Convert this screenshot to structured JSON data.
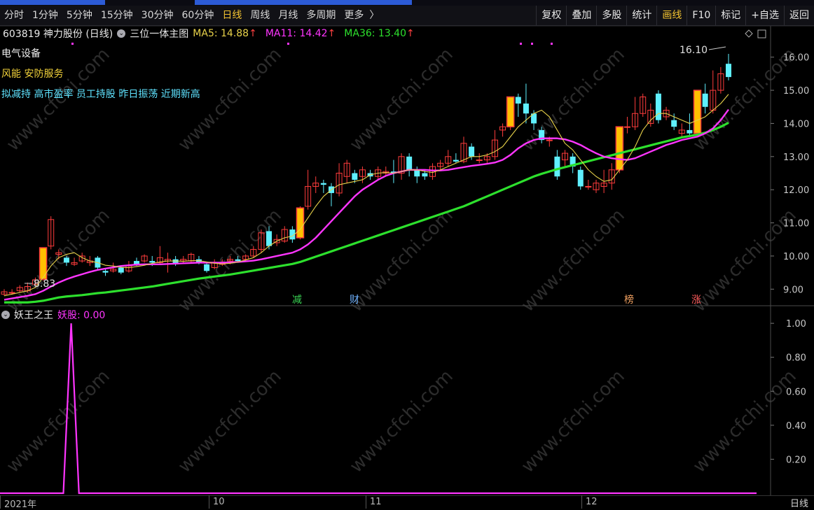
{
  "tabs": [
    "分时",
    "1分钟",
    "5分钟",
    "15分钟",
    "30分钟",
    "60分钟",
    "日线",
    "周线",
    "月线",
    "多周期",
    "更多"
  ],
  "active_tab": "日线",
  "right_buttons": [
    "复权",
    "叠加",
    "多股",
    "统计",
    "画线",
    "F10",
    "标记",
    "+自选",
    "返回"
  ],
  "highlight_button": "画线",
  "title": {
    "code_name": "603819 神力股份 (日线)",
    "indicator": "三位一体主图",
    "ma5": "MA5: 14.88",
    "ma11": "MA11: 14.42",
    "ma36": "MA36: 13.40",
    "arrow": "↑"
  },
  "annotations": {
    "industry": "电气设备",
    "concepts": "风能 安防服务",
    "tags": "拟减持 高市盈率 员工持股 昨日振荡 近期新高"
  },
  "sub": {
    "name": "妖王之王",
    "value": "妖股: 0.00"
  },
  "markers": [
    {
      "label": "减",
      "color": "#39d353"
    },
    {
      "label": "财",
      "color": "#6fb2ff"
    },
    {
      "label": "榜",
      "color": "#f0a060"
    },
    {
      "label": "涨",
      "color": "#ff5b5b"
    }
  ],
  "price_axis": [
    "16.00",
    "15.00",
    "14.00",
    "13.00",
    "12.00",
    "11.00",
    "10.00",
    "9.00"
  ],
  "sub_axis": [
    "1.00",
    "0.80",
    "0.60",
    "0.40",
    "0.20"
  ],
  "high_label": "16.10",
  "low_label": "8.83",
  "date_labels": [
    "2021年",
    "10",
    "11",
    "12"
  ],
  "period_label": "日线",
  "watermark": "www.cfchi.com",
  "colors": {
    "up": "#ff3c3c",
    "down": "#5ff0ff",
    "ma5": "#e8d24a",
    "ma11": "#ff35ff",
    "ma36": "#2de02d",
    "special": "#ffc000",
    "sub_line": "#ff35ff"
  },
  "chart_data": {
    "type": "candlestick",
    "ylim": [
      8.5,
      16.5
    ],
    "candles": [
      [
        8.85,
        8.92,
        8.8,
        9.0
      ],
      [
        8.9,
        8.9,
        8.83,
        9.0
      ],
      [
        8.95,
        9.05,
        8.9,
        9.12
      ],
      [
        8.95,
        9.08,
        8.9,
        9.2
      ],
      [
        9.15,
        9.28,
        9.1,
        9.35
      ],
      [
        9.3,
        10.25,
        9.25,
        10.25
      ],
      [
        10.3,
        11.1,
        10.2,
        11.2
      ],
      [
        10.05,
        10.1,
        9.9,
        10.2
      ],
      [
        9.95,
        9.8,
        9.7,
        10.0
      ],
      [
        9.75,
        9.8,
        9.7,
        9.95
      ],
      [
        9.85,
        10.0,
        9.8,
        10.1
      ],
      [
        9.8,
        9.85,
        9.7,
        10.0
      ],
      [
        9.95,
        9.65,
        9.6,
        10.0
      ],
      [
        9.55,
        9.5,
        9.4,
        9.6
      ],
      [
        9.55,
        9.6,
        9.5,
        9.8
      ],
      [
        9.65,
        9.5,
        9.45,
        9.7
      ],
      [
        9.55,
        9.7,
        9.5,
        9.85
      ],
      [
        9.85,
        9.75,
        9.7,
        9.95
      ],
      [
        9.85,
        10.0,
        9.8,
        10.05
      ],
      [
        9.85,
        9.8,
        9.7,
        10.0
      ],
      [
        9.8,
        9.95,
        9.75,
        10.3
      ],
      [
        9.85,
        9.9,
        9.5,
        10.1
      ],
      [
        9.9,
        9.75,
        9.7,
        10.0
      ],
      [
        9.85,
        9.9,
        9.8,
        10.0
      ],
      [
        9.85,
        10.05,
        9.8,
        10.1
      ],
      [
        9.9,
        9.8,
        9.75,
        10.0
      ],
      [
        9.75,
        9.55,
        9.5,
        9.8
      ],
      [
        9.65,
        9.8,
        9.6,
        9.9
      ],
      [
        9.75,
        9.8,
        9.7,
        9.9
      ],
      [
        9.85,
        9.9,
        9.75,
        10.0
      ],
      [
        9.9,
        9.85,
        9.8,
        10.0
      ],
      [
        9.9,
        10.0,
        9.85,
        10.05
      ],
      [
        10.0,
        10.2,
        9.95,
        10.3
      ],
      [
        10.2,
        10.7,
        10.1,
        10.8
      ],
      [
        10.75,
        10.3,
        10.2,
        10.9
      ],
      [
        10.4,
        10.5,
        10.3,
        10.65
      ],
      [
        10.45,
        10.8,
        10.4,
        10.9
      ],
      [
        10.8,
        10.5,
        10.4,
        10.9
      ],
      [
        10.55,
        11.45,
        10.5,
        11.5
      ],
      [
        11.5,
        12.1,
        11.4,
        12.6
      ],
      [
        12.1,
        12.2,
        11.9,
        12.4
      ],
      [
        12.2,
        12.15,
        11.9,
        12.3
      ],
      [
        12.1,
        11.9,
        11.5,
        12.2
      ],
      [
        11.9,
        12.5,
        11.8,
        12.8
      ],
      [
        12.4,
        12.8,
        12.2,
        12.9
      ],
      [
        12.5,
        12.3,
        12.2,
        12.6
      ],
      [
        12.4,
        12.6,
        12.2,
        12.7
      ],
      [
        12.5,
        12.4,
        12.3,
        12.6
      ],
      [
        12.4,
        12.6,
        12.3,
        12.7
      ],
      [
        12.5,
        12.55,
        12.4,
        12.7
      ],
      [
        12.55,
        12.5,
        12.2,
        12.9
      ],
      [
        12.5,
        13.0,
        12.3,
        13.1
      ],
      [
        13.0,
        12.6,
        12.4,
        13.1
      ],
      [
        12.6,
        12.4,
        12.2,
        12.7
      ],
      [
        12.5,
        12.4,
        12.3,
        12.6
      ],
      [
        12.4,
        12.7,
        12.3,
        12.8
      ],
      [
        12.7,
        12.8,
        12.6,
        12.9
      ],
      [
        12.8,
        13.0,
        12.7,
        13.2
      ],
      [
        12.9,
        12.85,
        12.8,
        13.1
      ],
      [
        12.85,
        13.4,
        12.8,
        13.6
      ],
      [
        13.3,
        13.0,
        12.9,
        13.4
      ],
      [
        12.9,
        12.9,
        12.8,
        13.1
      ],
      [
        12.9,
        13.0,
        12.8,
        13.1
      ],
      [
        13.0,
        13.5,
        12.9,
        13.8
      ],
      [
        13.8,
        13.9,
        13.6,
        14.0
      ],
      [
        13.9,
        14.8,
        13.8,
        14.8
      ],
      [
        14.8,
        14.6,
        14.2,
        14.9
      ],
      [
        14.6,
        14.3,
        14.0,
        15.2
      ],
      [
        14.3,
        14.0,
        13.8,
        14.4
      ],
      [
        13.8,
        13.5,
        13.4,
        13.9
      ],
      [
        13.5,
        13.5,
        13.3,
        13.6
      ],
      [
        13.0,
        12.4,
        12.3,
        13.2
      ],
      [
        12.9,
        13.1,
        12.7,
        13.2
      ],
      [
        13.0,
        12.7,
        12.5,
        13.1
      ],
      [
        12.6,
        12.1,
        12.0,
        12.7
      ],
      [
        12.1,
        12.1,
        12.0,
        12.3
      ],
      [
        12.0,
        12.2,
        11.9,
        12.3
      ],
      [
        12.1,
        12.2,
        11.9,
        12.6
      ],
      [
        12.2,
        12.6,
        12.0,
        12.8
      ],
      [
        12.6,
        13.9,
        12.5,
        13.9
      ],
      [
        13.9,
        13.9,
        13.7,
        14.2
      ],
      [
        13.9,
        14.3,
        13.8,
        14.8
      ],
      [
        14.3,
        14.8,
        14.2,
        14.9
      ],
      [
        14.0,
        14.4,
        13.9,
        14.6
      ],
      [
        14.9,
        14.1,
        14.0,
        15.0
      ],
      [
        14.2,
        14.4,
        14.1,
        14.5
      ],
      [
        14.1,
        13.9,
        13.8,
        14.3
      ],
      [
        13.7,
        13.8,
        13.6,
        14.0
      ],
      [
        13.8,
        13.7,
        13.6,
        14.3
      ],
      [
        13.7,
        15.0,
        13.6,
        15.0
      ],
      [
        14.9,
        14.5,
        14.3,
        15.2
      ],
      [
        14.4,
        15.0,
        14.3,
        15.6
      ],
      [
        15.0,
        15.5,
        14.9,
        15.7
      ],
      [
        15.8,
        15.4,
        15.3,
        16.1
      ]
    ],
    "special_candles": [
      5,
      38,
      65,
      79,
      89
    ],
    "ma5": [
      8.8,
      8.85,
      8.9,
      8.95,
      9.05,
      9.35,
      9.7,
      9.95,
      10.05,
      10.1,
      9.95,
      9.85,
      9.8,
      9.72,
      9.7,
      9.66,
      9.65,
      9.68,
      9.72,
      9.78,
      9.82,
      9.85,
      9.85,
      9.84,
      9.86,
      9.86,
      9.82,
      9.78,
      9.76,
      9.78,
      9.82,
      9.88,
      9.95,
      10.1,
      10.3,
      10.45,
      10.55,
      10.6,
      10.8,
      11.15,
      11.5,
      11.8,
      12.0,
      12.15,
      12.2,
      12.25,
      12.3,
      12.45,
      12.5,
      12.52,
      12.5,
      12.55,
      12.6,
      12.6,
      12.55,
      12.52,
      12.6,
      12.7,
      12.8,
      12.9,
      13.0,
      13.0,
      13.05,
      13.15,
      13.3,
      13.6,
      13.9,
      14.1,
      14.3,
      14.4,
      14.2,
      13.8,
      13.4,
      13.2,
      12.9,
      12.6,
      12.4,
      12.25,
      12.3,
      12.6,
      12.9,
      13.3,
      13.8,
      14.1,
      14.3,
      14.3,
      14.2,
      14.1,
      14.0,
      14.1,
      14.2,
      14.4,
      14.6,
      14.88
    ],
    "ma11": [
      8.68,
      8.72,
      8.76,
      8.8,
      8.85,
      8.95,
      9.08,
      9.2,
      9.3,
      9.38,
      9.45,
      9.52,
      9.58,
      9.62,
      9.66,
      9.7,
      9.72,
      9.74,
      9.75,
      9.75,
      9.75,
      9.76,
      9.77,
      9.78,
      9.79,
      9.8,
      9.8,
      9.8,
      9.8,
      9.81,
      9.82,
      9.84,
      9.86,
      9.9,
      9.95,
      10.0,
      10.05,
      10.1,
      10.2,
      10.35,
      10.55,
      10.8,
      11.05,
      11.3,
      11.55,
      11.8,
      12.0,
      12.15,
      12.3,
      12.42,
      12.5,
      12.55,
      12.6,
      12.6,
      12.6,
      12.58,
      12.58,
      12.6,
      12.64,
      12.68,
      12.72,
      12.75,
      12.78,
      12.82,
      12.9,
      13.05,
      13.25,
      13.4,
      13.5,
      13.55,
      13.55,
      13.55,
      13.52,
      13.45,
      13.35,
      13.22,
      13.1,
      13.0,
      12.95,
      12.92,
      12.9,
      12.95,
      13.05,
      13.15,
      13.25,
      13.35,
      13.42,
      13.5,
      13.55,
      13.6,
      13.7,
      13.85,
      14.1,
      14.42
    ],
    "ma36": [
      8.6,
      8.6,
      8.6,
      8.6,
      8.62,
      8.65,
      8.7,
      8.75,
      8.78,
      8.8,
      8.82,
      8.85,
      8.88,
      8.9,
      8.93,
      8.96,
      8.99,
      9.02,
      9.05,
      9.08,
      9.12,
      9.16,
      9.2,
      9.24,
      9.28,
      9.32,
      9.35,
      9.38,
      9.41,
      9.44,
      9.48,
      9.52,
      9.56,
      9.6,
      9.64,
      9.68,
      9.72,
      9.76,
      9.82,
      9.9,
      9.98,
      10.06,
      10.14,
      10.22,
      10.3,
      10.38,
      10.46,
      10.54,
      10.62,
      10.7,
      10.78,
      10.86,
      10.94,
      11.02,
      11.1,
      11.18,
      11.26,
      11.34,
      11.42,
      11.5,
      11.6,
      11.7,
      11.8,
      11.9,
      12.0,
      12.1,
      12.2,
      12.3,
      12.4,
      12.48,
      12.55,
      12.62,
      12.68,
      12.74,
      12.8,
      12.86,
      12.92,
      12.98,
      13.04,
      13.1,
      13.16,
      13.22,
      13.28,
      13.34,
      13.4,
      13.46,
      13.52,
      13.58,
      13.62,
      13.66,
      13.72,
      13.8,
      13.9,
      14.02
    ],
    "sub_series": [
      0,
      0,
      0,
      0,
      0,
      1,
      0,
      0,
      0,
      0,
      0,
      0,
      0,
      0,
      0,
      0,
      0,
      0,
      0,
      0,
      0,
      0,
      0,
      0,
      0,
      0,
      0,
      0,
      0,
      0,
      0,
      0,
      0,
      0,
      0,
      0,
      0,
      0,
      0,
      0,
      0,
      0,
      0,
      0,
      0,
      0,
      0,
      0,
      0,
      0,
      0,
      0,
      0,
      0,
      0,
      0,
      0,
      0,
      0,
      0,
      0,
      0,
      0,
      0,
      0,
      0,
      0,
      0,
      0,
      0,
      0,
      0,
      0,
      0,
      0,
      0,
      0,
      0,
      0,
      0,
      0,
      0,
      0,
      0,
      0,
      0,
      0,
      0,
      0,
      0,
      0,
      0,
      0,
      0
    ],
    "sub_ylim": [
      0,
      1.05
    ]
  }
}
